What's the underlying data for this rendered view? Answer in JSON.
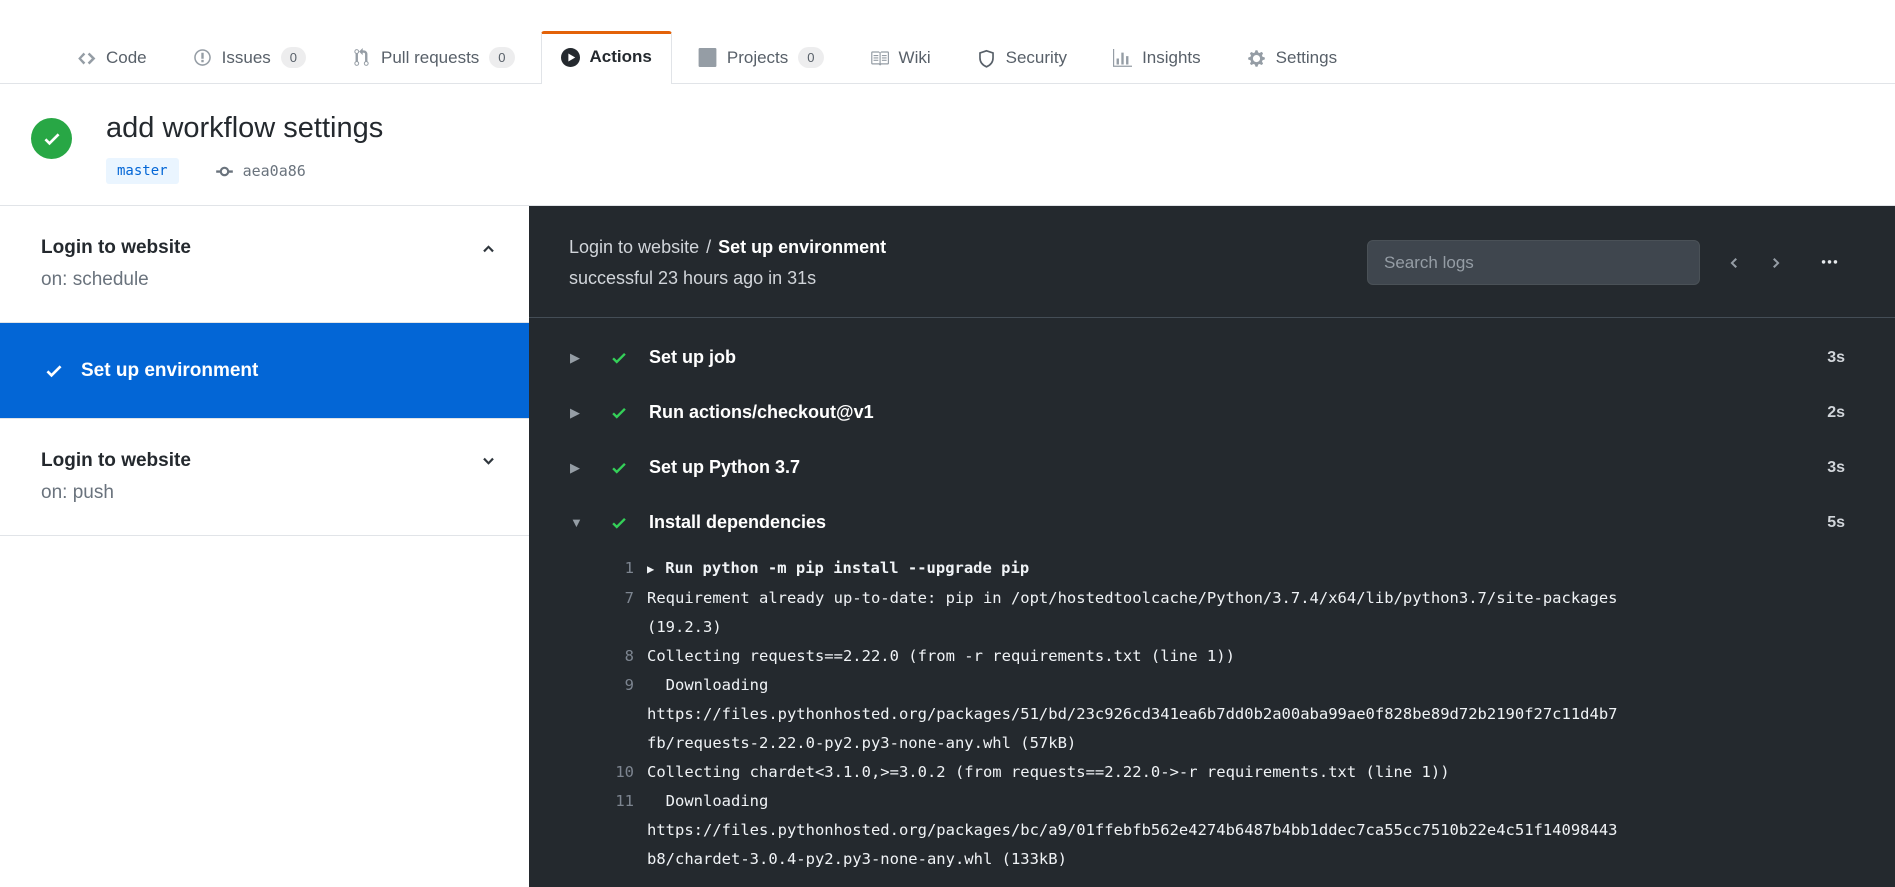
{
  "nav": {
    "tabs": [
      {
        "label": "Code",
        "icon": "code",
        "active": false
      },
      {
        "label": "Issues",
        "icon": "issue",
        "count": "0",
        "active": false
      },
      {
        "label": "Pull requests",
        "icon": "pull-request",
        "count": "0",
        "active": false
      },
      {
        "label": "Actions",
        "icon": "play",
        "active": true
      },
      {
        "label": "Projects",
        "icon": "project",
        "count": "0",
        "active": false
      },
      {
        "label": "Wiki",
        "icon": "book",
        "active": false
      },
      {
        "label": "Security",
        "icon": "shield",
        "active": false
      },
      {
        "label": "Insights",
        "icon": "graph",
        "active": false
      },
      {
        "label": "Settings",
        "icon": "gear",
        "active": false
      }
    ]
  },
  "run_header": {
    "title": "add workflow settings",
    "status": "success",
    "branch": "master",
    "commit": "aea0a86"
  },
  "sidebar": {
    "jobs": [
      {
        "title": "Login to website",
        "subtitle": "on: schedule",
        "expanded": true,
        "steps": [
          {
            "label": "Set up environment",
            "status": "success",
            "selected": true
          }
        ]
      },
      {
        "title": "Login to website",
        "subtitle": "on: push",
        "expanded": false,
        "steps": []
      }
    ]
  },
  "log_panel": {
    "breadcrumb": {
      "job": "Login to website",
      "separator": "/",
      "step": "Set up environment"
    },
    "status_line": "successful 23 hours ago in 31s",
    "search_placeholder": "Search logs",
    "steps": [
      {
        "label": "Set up job",
        "duration": "3s",
        "status": "success",
        "expanded": false
      },
      {
        "label": "Run actions/checkout@v1",
        "duration": "2s",
        "status": "success",
        "expanded": false
      },
      {
        "label": "Set up Python 3.7",
        "duration": "3s",
        "status": "success",
        "expanded": false
      },
      {
        "label": "Install dependencies",
        "duration": "5s",
        "status": "success",
        "expanded": true
      }
    ],
    "log_lines": [
      {
        "num": "1",
        "toggle": true,
        "text": "Run python -m pip install --upgrade pip"
      },
      {
        "num": "7",
        "text": "Requirement already up-to-date: pip in /opt/hostedtoolcache/Python/3.7.4/x64/lib/python3.7/site-packages"
      },
      {
        "num": "",
        "text": "(19.2.3)"
      },
      {
        "num": "8",
        "text": "Collecting requests==2.22.0 (from -r requirements.txt (line 1))"
      },
      {
        "num": "9",
        "text": "  Downloading"
      },
      {
        "num": "",
        "text": "https://files.pythonhosted.org/packages/51/bd/23c926cd341ea6b7dd0b2a00aba99ae0f828be89d72b2190f27c11d4b7"
      },
      {
        "num": "",
        "text": "fb/requests-2.22.0-py2.py3-none-any.whl (57kB)"
      },
      {
        "num": "10",
        "text": "Collecting chardet<3.1.0,>=3.0.2 (from requests==2.22.0->-r requirements.txt (line 1))"
      },
      {
        "num": "11",
        "text": "  Downloading"
      },
      {
        "num": "",
        "text": "https://files.pythonhosted.org/packages/bc/a9/01ffebfb562e4274b6487b4bb1ddec7ca55cc7510b22e4c51f14098443"
      },
      {
        "num": "",
        "text": "b8/chardet-3.0.4-py2.py3-none-any.whl (133kB)"
      }
    ]
  },
  "colors": {
    "tab_accent_orange": "#e36209",
    "success_green": "#28a745",
    "success_green_dark_bg": "#34d058",
    "selected_step_blue": "#0366d6",
    "branch_badge_bg": "#eaf5ff",
    "branch_badge_text": "#0366d6",
    "log_panel_bg": "#24292e",
    "log_panel_border": "#444d56"
  }
}
